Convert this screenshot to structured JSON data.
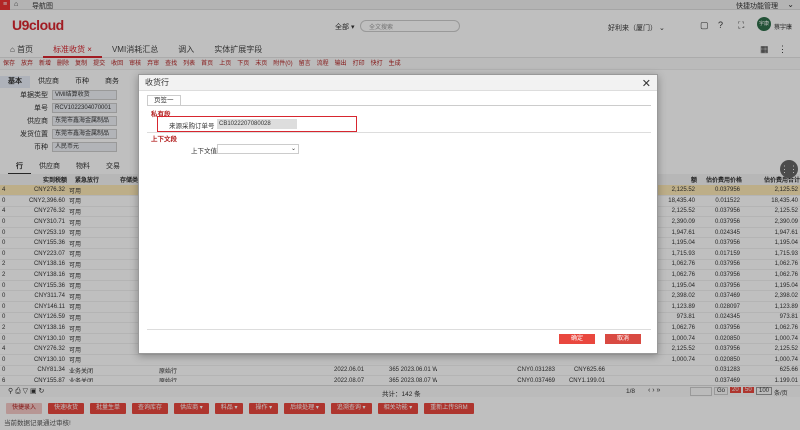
{
  "nav": {
    "title": "导航图",
    "top_right": "快捷功能管理"
  },
  "header": {
    "logo": "U9cloud",
    "scope": "全部",
    "search_placeholder": "全文搜索",
    "org": "好利来（厦门）",
    "user": "蔡宇康",
    "avatar": "宇康"
  },
  "tabs": [
    "首页",
    "标准收货",
    "VMI消耗汇总",
    "调入",
    "实体扩展字段"
  ],
  "toolbar": [
    "保存",
    "放弃",
    "新增",
    "删除",
    "复制",
    "提交",
    "收回",
    "审核",
    "弃审",
    "查找",
    "列表",
    "首页",
    "上页",
    "下页",
    "末页",
    "附件(0)",
    "留言",
    "流程",
    "输出",
    "打印",
    "快打",
    "生成"
  ],
  "subtabs": [
    "基本",
    "供应商",
    "币种",
    "商务"
  ],
  "form": [
    {
      "label": "单据类型",
      "value": "VMI结算收货"
    },
    {
      "label": "单号",
      "value": "RCV1022304070001"
    },
    {
      "label": "供应商",
      "value": "东莞市鑫海金属制品"
    },
    {
      "label": "发货位置",
      "value": "东莞市鑫海金属制品"
    },
    {
      "label": "币种",
      "value": "人民币元"
    }
  ],
  "grid_tabs": [
    "行",
    "供应商",
    "物料",
    "交易"
  ],
  "grid": {
    "headers_left": [
      "实到税额",
      "紧急放行",
      "存储类型"
    ],
    "headers_right": [
      "估价费用价格",
      "估价费用合计"
    ],
    "rows": [
      {
        "n": "4",
        "amt": "CNY276.32",
        "st": "可用",
        "r1": "2,125.52",
        "p": "0.037956",
        "t": "2,125.52"
      },
      {
        "n": "0",
        "amt": "CNY2,396.60",
        "st": "可用",
        "r1": "18,435.40",
        "p": "0.011522",
        "t": "18,435.40"
      },
      {
        "n": "4",
        "amt": "CNY276.32",
        "st": "可用",
        "r1": "2,125.52",
        "p": "0.037956",
        "t": "2,125.52"
      },
      {
        "n": "0",
        "amt": "CNY310.71",
        "st": "可用",
        "r1": "2,390.09",
        "p": "0.037956",
        "t": "2,390.09"
      },
      {
        "n": "0",
        "amt": "CNY253.19",
        "st": "可用",
        "r1": "1,947.61",
        "p": "0.024345",
        "t": "1,947.61"
      },
      {
        "n": "0",
        "amt": "CNY155.36",
        "st": "可用",
        "r1": "1,195.04",
        "p": "0.037956",
        "t": "1,195.04"
      },
      {
        "n": "0",
        "amt": "CNY223.07",
        "st": "可用",
        "r1": "1,715.93",
        "p": "0.017159",
        "t": "1,715.93"
      },
      {
        "n": "2",
        "amt": "CNY138.16",
        "st": "可用",
        "r1": "1,062.76",
        "p": "0.037956",
        "t": "1,062.76"
      },
      {
        "n": "2",
        "amt": "CNY138.16",
        "st": "可用",
        "r1": "1,062.76",
        "p": "0.037956",
        "t": "1,062.76"
      },
      {
        "n": "0",
        "amt": "CNY155.36",
        "st": "可用",
        "r1": "1,195.04",
        "p": "0.037956",
        "t": "1,195.04"
      },
      {
        "n": "0",
        "amt": "CNY311.74",
        "st": "可用",
        "r1": "2,398.02",
        "p": "0.037469",
        "t": "2,398.02"
      },
      {
        "n": "0",
        "amt": "CNY146.11",
        "st": "可用",
        "r1": "1,123.89",
        "p": "0.028097",
        "t": "1,123.89"
      },
      {
        "n": "0",
        "amt": "CNY126.59",
        "st": "可用",
        "r1": "973.81",
        "p": "0.024345",
        "t": "973.81"
      },
      {
        "n": "2",
        "amt": "CNY138.16",
        "st": "可用",
        "r1": "1,062.76",
        "p": "0.037956",
        "t": "1,062.76"
      },
      {
        "n": "0",
        "amt": "CNY130.10",
        "st": "可用",
        "r1": "1,000.74",
        "p": "0.020850",
        "t": "1,000.74"
      },
      {
        "n": "4",
        "amt": "CNY276.32",
        "st": "可用",
        "r1": "2,125.52",
        "p": "0.037956",
        "t": "2,125.52"
      },
      {
        "n": "0",
        "amt": "CNY130.10",
        "st": "可用",
        "r1": "1,000.74",
        "p": "0.020850",
        "t": "1,000.74"
      },
      {
        "n": "0",
        "amt": "CNY81.34",
        "st": "业务关闭",
        "mid": "原始行",
        "d": "2022.06.01",
        "c": "365 2023.06.01 W27220601H-...",
        "cu": "CNY0.031283",
        "cu2": "CNY625.66",
        "p": "0.031283",
        "t": "625.66"
      },
      {
        "n": "6",
        "amt": "CNY155.87",
        "st": "业务关闭",
        "mid": "原始行",
        "d": "2022.08.07",
        "c": "365 2023.08.07 W11020807H-...",
        "cu": "CNY0.037469",
        "cu2": "CNY1,199.01",
        "p": "0.037469",
        "t": "1,199.01"
      }
    ]
  },
  "footer": {
    "total": "共计：142 条",
    "page": "1/8",
    "sizes": [
      "20",
      "50",
      "100"
    ],
    "per": "条/页"
  },
  "buttons": [
    "快捷录入",
    "快速收货",
    "批量生单",
    "查询库存",
    "供应商",
    "料品",
    "操作",
    "后续处理",
    "追溯查询",
    "相关功能",
    "重新上传SRM"
  ],
  "status": "当前数据记录通过审核!",
  "modal": {
    "title": "收货行",
    "tab": "页签一",
    "section1": "私有段",
    "field1_label": "来源采购订单号",
    "field1_value": "CB1022207080028",
    "section2": "上下文段",
    "field2_label": "上下文值",
    "ok": "确定",
    "cancel": "取消"
  },
  "colors": {
    "brand": "#d7262f",
    "highlight_row": "#fde9b6"
  }
}
